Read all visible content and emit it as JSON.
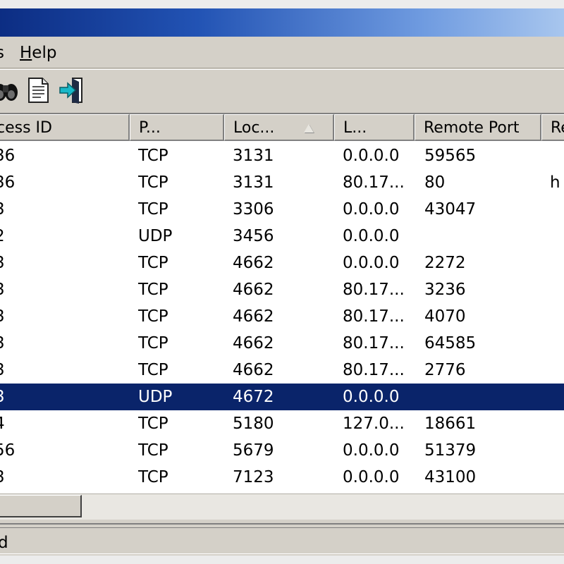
{
  "menu": {
    "prev_label": "s",
    "help_first": "H",
    "help_rest": "elp"
  },
  "toolbar": {
    "icons": [
      "find-icon",
      "document-icon",
      "exit-icon"
    ]
  },
  "table": {
    "columns": [
      "cess ID",
      "P...",
      "Loc...",
      "L...",
      "Remote Port",
      "Re"
    ],
    "sort_column": "Loc...",
    "rows": [
      [
        "36",
        "TCP",
        "3131",
        "0.0.0.0",
        "59565",
        ""
      ],
      [
        "36",
        "TCP",
        "3131",
        "80.17...",
        "80",
        "h"
      ],
      [
        "3",
        "TCP",
        "3306",
        "0.0.0.0",
        "43047",
        ""
      ],
      [
        "2",
        "UDP",
        "3456",
        "0.0.0.0",
        "",
        ""
      ],
      [
        "3",
        "TCP",
        "4662",
        "0.0.0.0",
        "2272",
        ""
      ],
      [
        "3",
        "TCP",
        "4662",
        "80.17...",
        "3236",
        ""
      ],
      [
        "3",
        "TCP",
        "4662",
        "80.17...",
        "4070",
        ""
      ],
      [
        "3",
        "TCP",
        "4662",
        "80.17...",
        "64585",
        ""
      ],
      [
        "3",
        "TCP",
        "4662",
        "80.17...",
        "2776",
        ""
      ],
      [
        "3",
        "UDP",
        "4672",
        "0.0.0.0",
        "",
        ""
      ],
      [
        "4",
        "TCP",
        "5180",
        "127.0...",
        "18661",
        ""
      ],
      [
        "56",
        "TCP",
        "5679",
        "0.0.0.0",
        "51379",
        ""
      ],
      [
        "3",
        "TCP",
        "7123",
        "0.0.0.0",
        "43100",
        ""
      ]
    ],
    "selected_row": 9
  },
  "status": {
    "text": "d"
  },
  "colors": {
    "selection": "#0a246a",
    "titlebar_dark": "#0c2d83",
    "titlebar_light": "#a8c6ee",
    "face": "#d4d0c8"
  }
}
